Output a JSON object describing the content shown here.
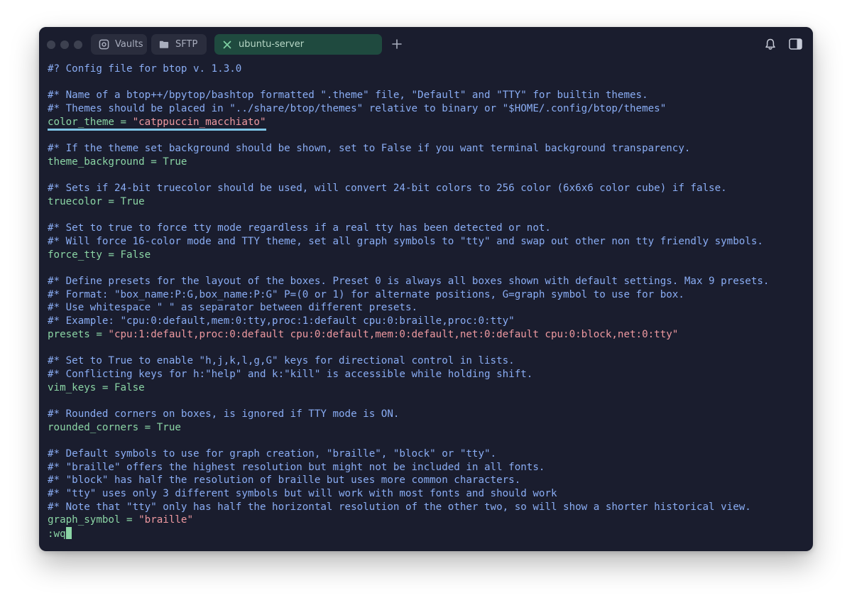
{
  "tabs": [
    {
      "label": "Vaults",
      "icon": "vault-icon"
    },
    {
      "label": "SFTP",
      "icon": "folder-icon"
    },
    {
      "label": "ubuntu-server",
      "icon": "close-icon",
      "active": true
    }
  ],
  "editor": {
    "lines": [
      {
        "type": "comment",
        "text": "#? Config file for btop v. 1.3.0"
      },
      {
        "type": "blank",
        "text": ""
      },
      {
        "type": "comment",
        "text": "#* Name of a btop++/bpytop/bashtop formatted \".theme\" file, \"Default\" and \"TTY\" for builtin themes."
      },
      {
        "type": "comment",
        "text": "#* Themes should be placed in \"../share/btop/themes\" relative to binary or \"$HOME/.config/btop/themes\""
      },
      {
        "type": "setting",
        "key": "color_theme",
        "op": " = ",
        "value": "\"catppuccin_macchiato\"",
        "value_type": "string",
        "highlight": true
      },
      {
        "type": "blank",
        "text": ""
      },
      {
        "type": "comment",
        "text": "#* If the theme set background should be shown, set to False if you want terminal background transparency."
      },
      {
        "type": "setting",
        "key": "theme_background",
        "op": " = ",
        "value": "True",
        "value_type": "plain"
      },
      {
        "type": "blank",
        "text": ""
      },
      {
        "type": "comment",
        "text": "#* Sets if 24-bit truecolor should be used, will convert 24-bit colors to 256 color (6x6x6 color cube) if false."
      },
      {
        "type": "setting",
        "key": "truecolor",
        "op": " = ",
        "value": "True",
        "value_type": "plain"
      },
      {
        "type": "blank",
        "text": ""
      },
      {
        "type": "comment",
        "text": "#* Set to true to force tty mode regardless if a real tty has been detected or not."
      },
      {
        "type": "comment",
        "text": "#* Will force 16-color mode and TTY theme, set all graph symbols to \"tty\" and swap out other non tty friendly symbols."
      },
      {
        "type": "setting",
        "key": "force_tty",
        "op": " = ",
        "value": "False",
        "value_type": "plain"
      },
      {
        "type": "blank",
        "text": ""
      },
      {
        "type": "comment",
        "text": "#* Define presets for the layout of the boxes. Preset 0 is always all boxes shown with default settings. Max 9 presets."
      },
      {
        "type": "comment",
        "text": "#* Format: \"box_name:P:G,box_name:P:G\" P=(0 or 1) for alternate positions, G=graph symbol to use for box."
      },
      {
        "type": "comment",
        "text": "#* Use whitespace \" \" as separator between different presets."
      },
      {
        "type": "comment",
        "text": "#* Example: \"cpu:0:default,mem:0:tty,proc:1:default cpu:0:braille,proc:0:tty\""
      },
      {
        "type": "setting",
        "key": "presets",
        "op": " = ",
        "value": "\"cpu:1:default,proc:0:default cpu:0:default,mem:0:default,net:0:default cpu:0:block,net:0:tty\"",
        "value_type": "string"
      },
      {
        "type": "blank",
        "text": ""
      },
      {
        "type": "comment",
        "text": "#* Set to True to enable \"h,j,k,l,g,G\" keys for directional control in lists."
      },
      {
        "type": "comment",
        "text": "#* Conflicting keys for h:\"help\" and k:\"kill\" is accessible while holding shift."
      },
      {
        "type": "setting",
        "key": "vim_keys",
        "op": " = ",
        "value": "False",
        "value_type": "plain"
      },
      {
        "type": "blank",
        "text": ""
      },
      {
        "type": "comment",
        "text": "#* Rounded corners on boxes, is ignored if TTY mode is ON."
      },
      {
        "type": "setting",
        "key": "rounded_corners",
        "op": " = ",
        "value": "True",
        "value_type": "plain"
      },
      {
        "type": "blank",
        "text": ""
      },
      {
        "type": "comment",
        "text": "#* Default symbols to use for graph creation, \"braille\", \"block\" or \"tty\"."
      },
      {
        "type": "comment",
        "text": "#* \"braille\" offers the highest resolution but might not be included in all fonts."
      },
      {
        "type": "comment",
        "text": "#* \"block\" has half the resolution of braille but uses more common characters."
      },
      {
        "type": "comment",
        "text": "#* \"tty\" uses only 3 different symbols but will work with most fonts and should work"
      },
      {
        "type": "comment",
        "text": "#* Note that \"tty\" only has half the horizontal resolution of the other two, so will show a shorter historical view."
      },
      {
        "type": "setting",
        "key": "graph_symbol",
        "op": " = ",
        "value": "\"braille\"",
        "value_type": "string"
      },
      {
        "type": "command",
        "text": ":wq"
      }
    ]
  },
  "colors": {
    "background": "#1a1d2e",
    "comment": "#8aadf4",
    "key": "#8bd5a5",
    "string": "#ee99a0",
    "active_tab": "#1f4a3f",
    "highlight_underline": "#7dc4e4"
  }
}
